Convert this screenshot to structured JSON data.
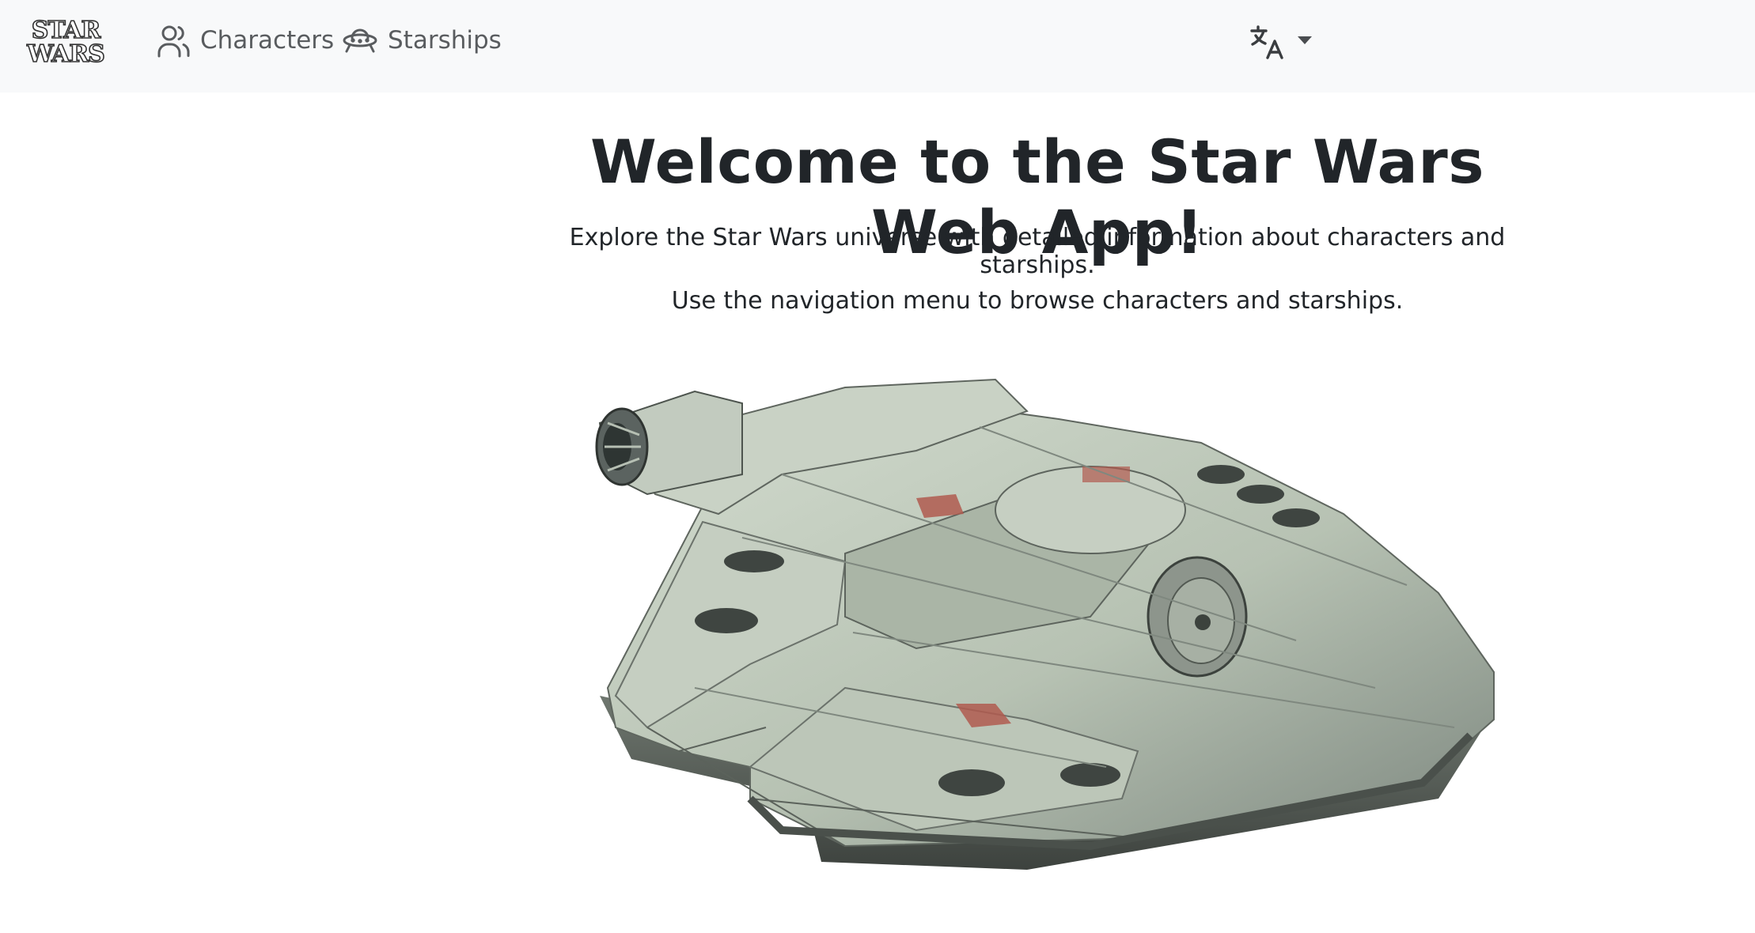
{
  "brand": {
    "logo_line1": "STAR",
    "logo_line2": "WARS"
  },
  "nav": {
    "characters_label": "Characters",
    "starships_label": "Starships"
  },
  "language": {
    "icon": "translate-icon"
  },
  "hero": {
    "title": "Welcome to the Star Wars Web App!",
    "subtitle": "Explore the Star Wars universe with detailed information about characters and starships.",
    "instructions": "Use the navigation menu to browse characters and starships."
  },
  "image": {
    "subject": "millennium-falcon"
  }
}
